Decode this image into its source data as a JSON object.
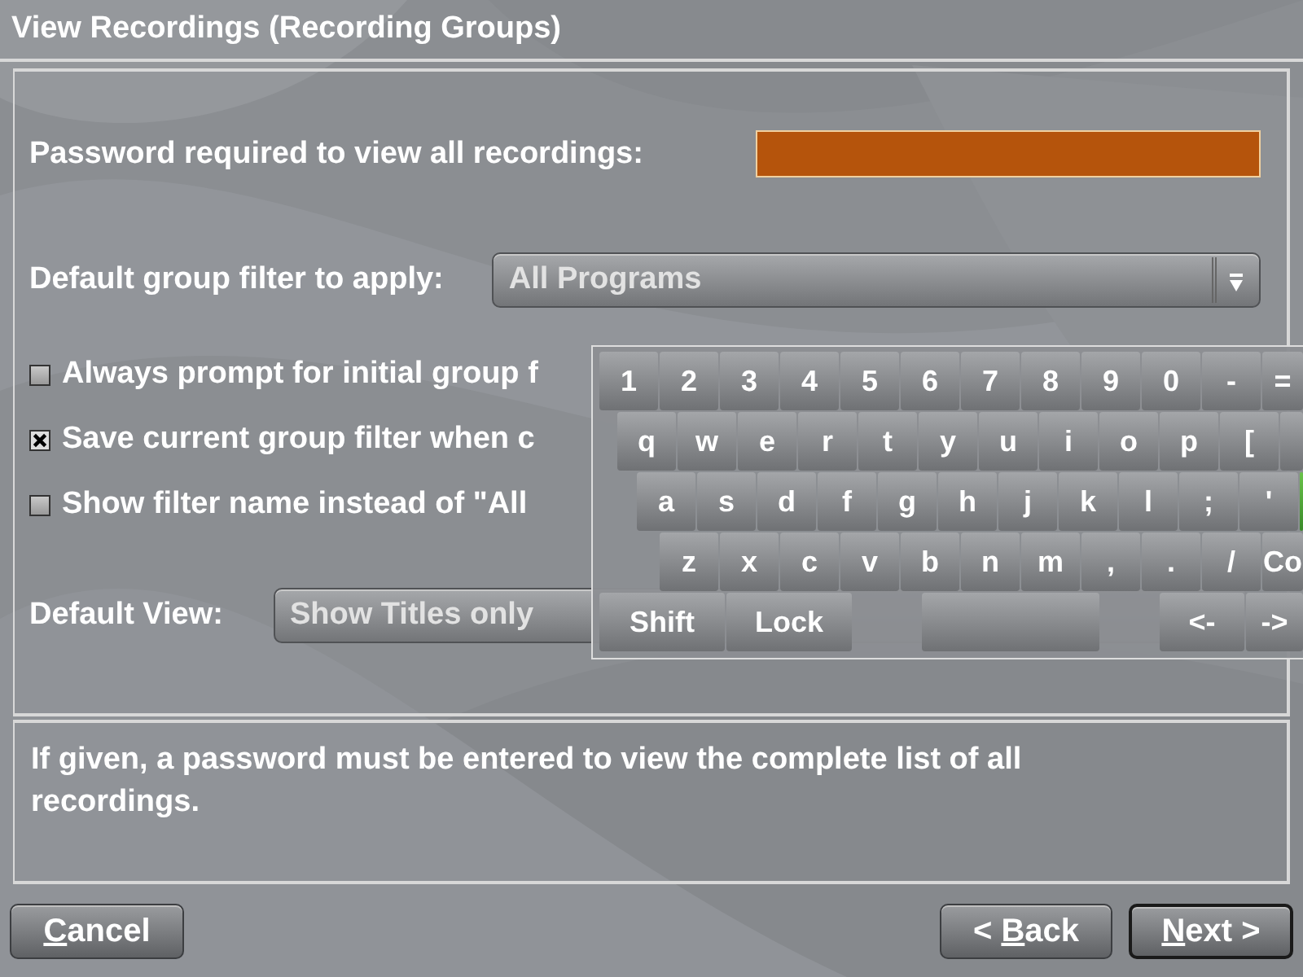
{
  "window": {
    "title": "View Recordings (Recording Groups)"
  },
  "password": {
    "label": "Password required to view all recordings:",
    "focused": true
  },
  "group_filter": {
    "label": "Default group filter to apply:",
    "value": "All Programs"
  },
  "checkboxes": [
    {
      "label": "Always prompt for initial group f",
      "checked": false
    },
    {
      "label": "Save current group filter when c",
      "checked": true
    },
    {
      "label": "Show filter name instead of \"All",
      "checked": false
    }
  ],
  "default_view": {
    "label": "Default View:",
    "value": "Show Titles only"
  },
  "help_text": "If given, a password must be entered to view the complete list of all recordings.",
  "keyboard": {
    "rows": [
      {
        "keys": [
          {
            "kind": "key",
            "label": "1"
          },
          {
            "kind": "key",
            "label": "2"
          },
          {
            "kind": "key",
            "label": "3"
          },
          {
            "kind": "key",
            "label": "4"
          },
          {
            "kind": "key",
            "label": "5"
          },
          {
            "kind": "key",
            "label": "6"
          },
          {
            "kind": "key",
            "label": "7"
          },
          {
            "kind": "key",
            "label": "8"
          },
          {
            "kind": "key",
            "label": "9"
          },
          {
            "kind": "key",
            "label": "0"
          },
          {
            "kind": "key",
            "label": "-"
          },
          {
            "kind": "key",
            "label": "="
          }
        ]
      },
      {
        "keys": [
          {
            "kind": "key",
            "label": "q"
          },
          {
            "kind": "key",
            "label": "w"
          },
          {
            "kind": "key",
            "label": "e"
          },
          {
            "kind": "key",
            "label": "r"
          },
          {
            "kind": "key",
            "label": "t"
          },
          {
            "kind": "key",
            "label": "y"
          },
          {
            "kind": "key",
            "label": "u"
          },
          {
            "kind": "key",
            "label": "i"
          },
          {
            "kind": "key",
            "label": "o"
          },
          {
            "kind": "key",
            "label": "p"
          },
          {
            "kind": "key",
            "label": "["
          },
          {
            "kind": "blank"
          }
        ]
      },
      {
        "keys": [
          {
            "kind": "key",
            "label": "a"
          },
          {
            "kind": "key",
            "label": "s"
          },
          {
            "kind": "key",
            "label": "d"
          },
          {
            "kind": "key",
            "label": "f"
          },
          {
            "kind": "key",
            "label": "g"
          },
          {
            "kind": "key",
            "label": "h"
          },
          {
            "kind": "key",
            "label": "j"
          },
          {
            "kind": "key",
            "label": "k"
          },
          {
            "kind": "key",
            "label": "l"
          },
          {
            "kind": "key",
            "label": ";"
          },
          {
            "kind": "key",
            "label": "'"
          },
          {
            "kind": "highlighted"
          }
        ]
      },
      {
        "keys": [
          {
            "kind": "key",
            "label": "z"
          },
          {
            "kind": "key",
            "label": "x"
          },
          {
            "kind": "key",
            "label": "c"
          },
          {
            "kind": "key",
            "label": "v"
          },
          {
            "kind": "key",
            "label": "b"
          },
          {
            "kind": "key",
            "label": "n"
          },
          {
            "kind": "key",
            "label": "m"
          },
          {
            "kind": "key",
            "label": ","
          },
          {
            "kind": "key",
            "label": "."
          },
          {
            "kind": "key",
            "label": "/"
          },
          {
            "kind": "key",
            "label": "Co"
          }
        ]
      },
      {
        "keys": [
          {
            "kind": "wide",
            "label": "Shift"
          },
          {
            "kind": "wide",
            "label": "Lock"
          },
          {
            "kind": "gap"
          },
          {
            "kind": "space"
          },
          {
            "kind": "gap"
          },
          {
            "kind": "arrow",
            "label": "<-"
          },
          {
            "kind": "arrow",
            "label": "->"
          }
        ]
      }
    ]
  },
  "buttons": [
    {
      "key": "C",
      "rest": "ancel",
      "focused": false
    },
    {
      "prefix": "< ",
      "key": "B",
      "rest": "ack",
      "focused": false
    },
    {
      "key": "N",
      "rest": "ext >",
      "focused": true
    }
  ]
}
